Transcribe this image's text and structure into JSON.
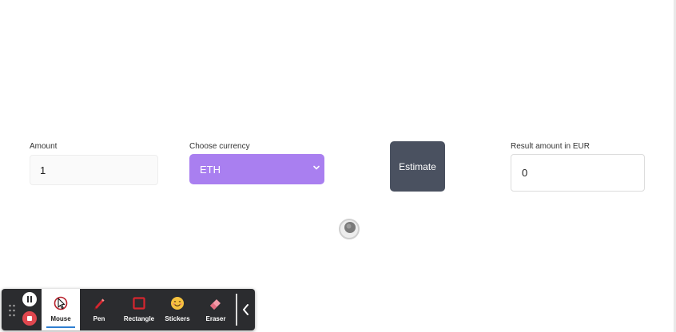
{
  "form": {
    "amount_label": "Amount",
    "amount_value": "1",
    "currency_label": "Choose currency",
    "currency_value": "ETH",
    "estimate_label": "Estimate",
    "result_label": "Result amount in EUR",
    "result_value": "0"
  },
  "colors": {
    "currency_bg": "#a97ff0",
    "estimate_bg": "#4a5160",
    "toolbar_bg": "#2b2c2f",
    "stop_red": "#e0474f",
    "active_underline": "#2f7fd1"
  },
  "toolbar": {
    "tools": [
      {
        "label": "Mouse",
        "icon": "mouse-pointer-icon",
        "active": true
      },
      {
        "label": "Pen",
        "icon": "pen-icon",
        "active": false
      },
      {
        "label": "Rectangle",
        "icon": "rectangle-icon",
        "active": false
      },
      {
        "label": "Stickers",
        "icon": "smiley-sticker-icon",
        "active": false
      },
      {
        "label": "Eraser",
        "icon": "eraser-icon",
        "active": false
      }
    ],
    "controls": [
      "pause-icon",
      "stop-icon",
      "drag-handle-icon",
      "chevron-left-icon"
    ]
  }
}
